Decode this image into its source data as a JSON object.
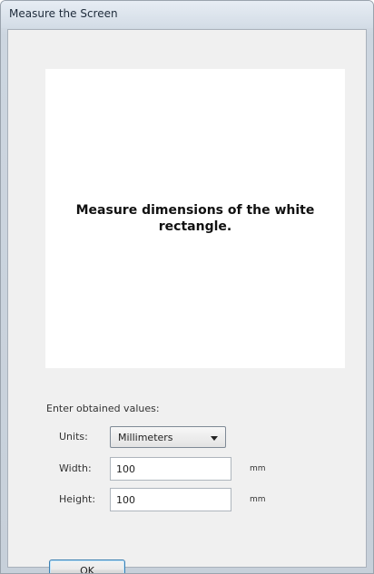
{
  "window": {
    "title": "Measure the Screen"
  },
  "measure_area": {
    "instruction": "Measure dimensions of the white rectangle."
  },
  "form": {
    "section_label": "Enter obtained values:",
    "units": {
      "label": "Units:",
      "selected": "Millimeters"
    },
    "width": {
      "label": "Width:",
      "value": "100",
      "unit": "mm"
    },
    "height": {
      "label": "Height:",
      "value": "100",
      "unit": "mm"
    }
  },
  "buttons": {
    "ok_label": "OK"
  }
}
